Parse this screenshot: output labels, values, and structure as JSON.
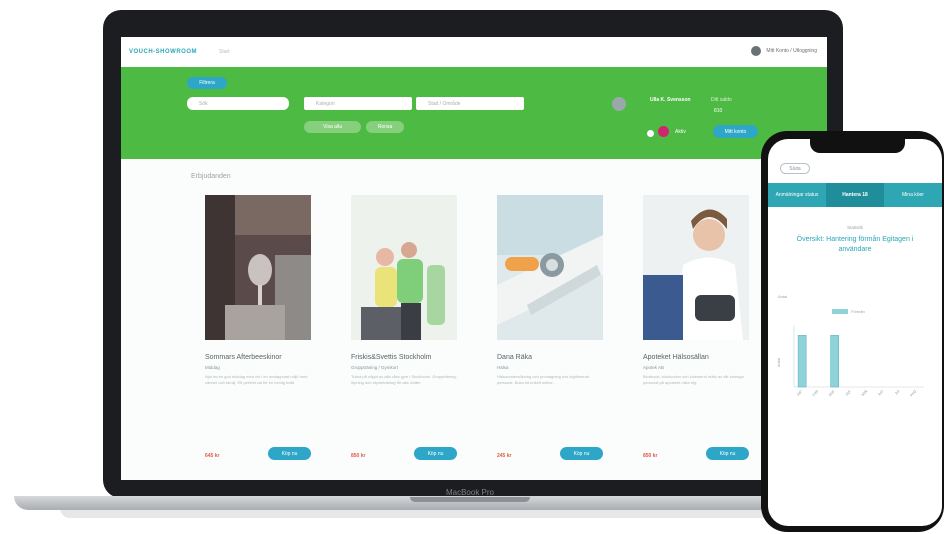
{
  "app": {
    "brand": "VOUCH-SHOWROOM",
    "nav_link": "Start",
    "account_label": "Mitt Konto / Utloggning"
  },
  "hero": {
    "filter_label": "Filtrera",
    "search_placeholder": "Sök",
    "select1_placeholder": "Kategori",
    "select2_placeholder": "Stad / Område",
    "chip1": "Visa alla",
    "chip2": "Rensa",
    "user_name": "Ulla K. Svensson",
    "balance_label": "Ditt saldo",
    "balance_value": "810",
    "status_label": "Aktiv",
    "cta_label": "Mitt konto"
  },
  "section_title": "Erbjudanden",
  "cards": [
    {
      "title": "Sommars Afterbeeskinor",
      "sub": "Middag",
      "desc": "Njut av en god middag med vin i en avslappnad miljö med vänner och familj. Ett perfekt val för en trevlig kväll.",
      "price": "645 kr",
      "button": "Köp nu"
    },
    {
      "title": "Friskis&Svettis Stockholm",
      "sub": "Gruppträning / Gymkort",
      "desc": "Träna på något av alla våra gym i Stockholm. Gruppträning, löpning och styrketräning för alla nivåer.",
      "price": "850 kr",
      "button": "Köp nu"
    },
    {
      "title": "Dana Räka",
      "sub": "Hälsa",
      "desc": "Hälsoundersökning och provtagning hos legitimerad personal. Boka tid enkelt online.",
      "price": "245 kr",
      "button": "Köp nu"
    },
    {
      "title": "Apoteket Hälsosällan",
      "sub": "Apotek AB",
      "desc": "Blodtryck, blodsocker och kolesterol mäts av vår kunniga personal på apoteket nära dig.",
      "price": "850 kr",
      "button": "Köp nu"
    }
  ],
  "laptop_label": "MacBook Pro",
  "phone": {
    "back_label": "Sluta",
    "tabs": [
      "Anmälningar status",
      "Hantera 18",
      "Mina köer"
    ],
    "small_label": "Statistik",
    "title": "Översikt: Hantering förmån Egitagen i användare",
    "axis_label": "Antal",
    "legend_label": "Förmån",
    "y_label": "Antal"
  },
  "chart_data": {
    "type": "bar",
    "categories": [
      "Jan",
      "Feb",
      "Mar",
      "Apr",
      "Maj",
      "Jun",
      "Jul",
      "Aug"
    ],
    "series": [
      {
        "name": "Förmån",
        "values": [
          1,
          0,
          1,
          0,
          0,
          0,
          0,
          0
        ]
      }
    ],
    "xlabel": "",
    "ylabel": "Antal",
    "ylim": [
      0,
      1.2
    ]
  },
  "colors": {
    "accent": "#2ea6c8",
    "hero_green": "#4dba43",
    "price_red": "#e05a45",
    "bar": "#8fd2d8"
  }
}
